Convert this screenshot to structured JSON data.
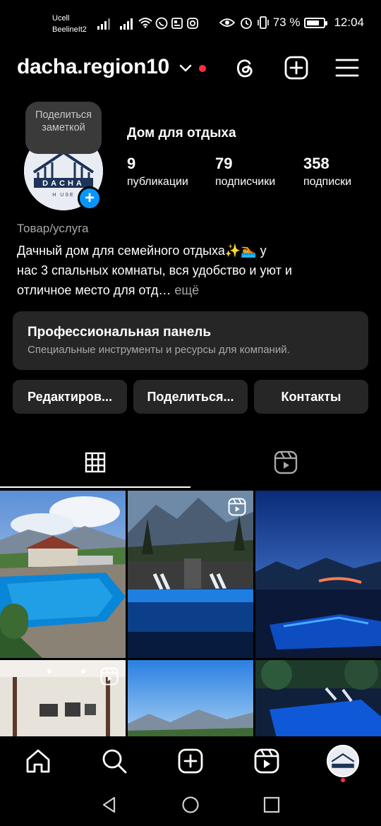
{
  "status_bar": {
    "carrier1": "Ucell",
    "carrier2": "BeelineIt2",
    "battery": "73 %",
    "battery_level": 0.73,
    "time": "12:04"
  },
  "header": {
    "username": "dacha.region10"
  },
  "profile": {
    "note": "Поделиться заметкой",
    "logo_text": "DACHA",
    "logo_sub": "H  USE",
    "name": "Дом для отдыха",
    "stats": [
      {
        "value": "9",
        "label": "публикации"
      },
      {
        "value": "79",
        "label": "подписчики"
      },
      {
        "value": "358",
        "label": "подписки"
      }
    ],
    "category": "Товар/услуга",
    "bio_line1": "Дачный дом для семейного отдыха✨🏊  у",
    "bio_line2": "нас 3 спальных комнаты, вся удобство и уют и",
    "bio_line3": "отличное место для отд…",
    "bio_more": " ещё"
  },
  "pro_panel": {
    "title": "Профессиональная панель",
    "subtitle": "Специальные инструменты и ресурсы для компаний."
  },
  "buttons": {
    "edit": "Редактиров...",
    "share": "Поделиться...",
    "contacts": "Контакты"
  },
  "tabs": [
    {
      "icon": "grid-icon",
      "active": true
    },
    {
      "icon": "reels-icon",
      "active": false
    }
  ],
  "posts": [
    {
      "kind": "photo",
      "scene": "pool-day"
    },
    {
      "kind": "reel",
      "scene": "pool-mountains-dusk"
    },
    {
      "kind": "photo",
      "scene": "pool-night"
    },
    {
      "kind": "reel",
      "scene": "interior"
    },
    {
      "kind": "photo",
      "scene": "sky-mountains"
    },
    {
      "kind": "photo",
      "scene": "pool-night-2"
    }
  ],
  "colors": {
    "accent_blue": "#0a95f6",
    "notification_red": "#ff3040",
    "panel_bg": "#262626",
    "secondary_text": "#a8a8a8"
  }
}
